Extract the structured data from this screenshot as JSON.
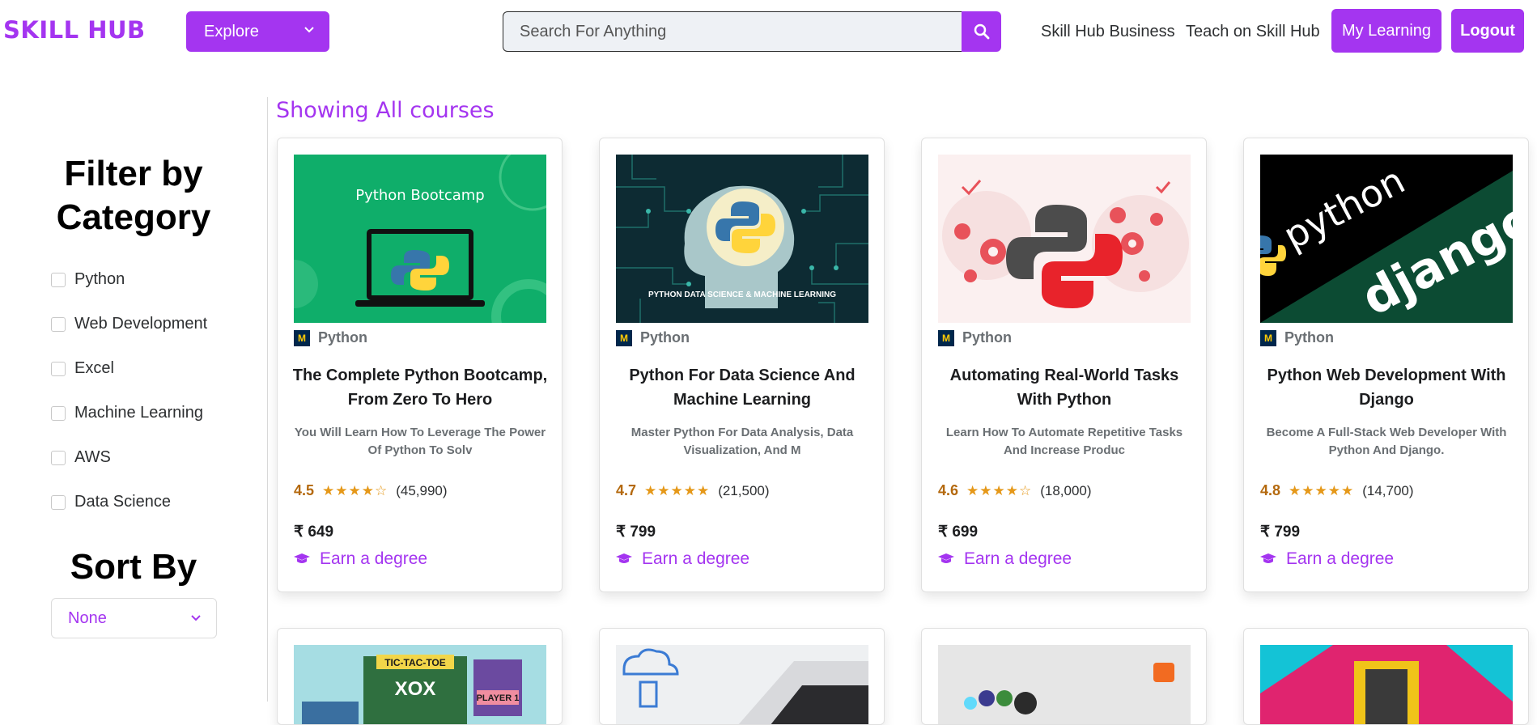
{
  "header": {
    "logo": "SKILL HUB",
    "explore_label": "Explore",
    "search_placeholder": "Search For Anything",
    "nav_business": "Skill Hub Business",
    "nav_teach": "Teach on Skill Hub",
    "my_learning": "My Learning",
    "logout": "Logout"
  },
  "sidebar": {
    "filter_title": "Filter by Category",
    "categories": [
      "Python",
      "Web Development",
      "Excel",
      "Machine Learning",
      "AWS",
      "Data Science"
    ],
    "sort_title": "Sort By",
    "sort_value": "None"
  },
  "main": {
    "heading": "Showing All courses",
    "courses": [
      {
        "provider": "Python",
        "title": "The Complete Python Bootcamp, From Zero To Hero",
        "description": "You Will Learn How To Leverage The Power Of Python To Solv",
        "rating": "4.5",
        "stars": "★★★★☆",
        "reviews": "(45,990)",
        "price": "₹ 649",
        "cta": "Earn a degree",
        "thumb_text": "Python Bootcamp"
      },
      {
        "provider": "Python",
        "title": "Python For Data Science And Machine Learning",
        "description": "Master Python For Data Analysis, Data Visualization, And M",
        "rating": "4.7",
        "stars": "★★★★★",
        "reviews": "(21,500)",
        "price": "₹ 799",
        "cta": "Earn a degree",
        "thumb_text": "PYTHON DATA SCIENCE & MACHINE LEARNING"
      },
      {
        "provider": "Python",
        "title": "Automating Real-World Tasks With Python",
        "description": "Learn How To Automate Repetitive Tasks And Increase Produc",
        "rating": "4.6",
        "stars": "★★★★☆",
        "reviews": "(18,000)",
        "price": "₹ 699",
        "cta": "Earn a degree"
      },
      {
        "provider": "Python",
        "title": "Python Web Development With Django",
        "description": "Become A Full-Stack Web Developer With Python And Django.",
        "rating": "4.8",
        "stars": "★★★★★",
        "reviews": "(14,700)",
        "price": "₹ 799",
        "cta": "Earn a degree",
        "thumb_text_1": "python",
        "thumb_text_2": "django"
      }
    ],
    "partial_thumbs": {
      "tictactoe_title": "TIC-TAC-TOE",
      "tictactoe_board": "XOX",
      "tictactoe_player": "PLAYER 1"
    }
  },
  "colors": {
    "accent": "#a435f0",
    "rating": "#b4690e",
    "star": "#e59819"
  }
}
